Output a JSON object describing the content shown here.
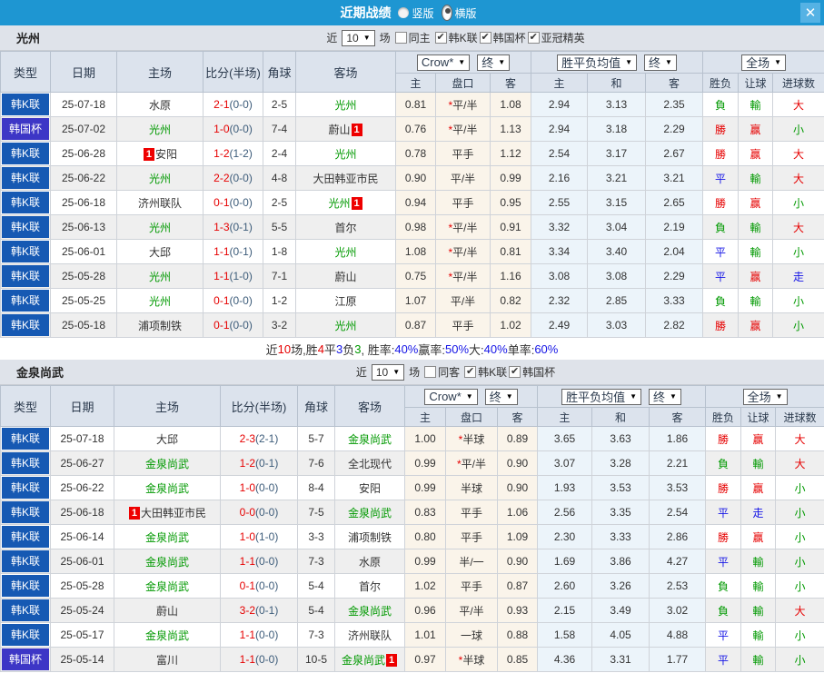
{
  "topbar": {
    "title": "近期战绩",
    "radio_vertical": "竖版",
    "radio_horizontal": "横版",
    "close": "✕"
  },
  "header_labels": {
    "cols": [
      "类型",
      "日期",
      "主场",
      "比分(半场)",
      "角球",
      "客场"
    ],
    "subs": [
      "主",
      "盘口",
      "客",
      "主",
      "和",
      "客",
      "胜负",
      "让球",
      "进球数"
    ],
    "selects": {
      "provider": "Crow*",
      "final": "终",
      "avg": "胜平负均值",
      "scope": "全场"
    }
  },
  "league_colors": {
    "韩K联": "#1659b3",
    "韩国杯": "#3d36c6"
  },
  "red_card_label": "1",
  "checkmark": "✔",
  "select_arrow": "▼",
  "sections": [
    {
      "team": "光州",
      "filter": {
        "near_label": "近",
        "games_value": "10",
        "games_suffix": "场",
        "same_label": "同主",
        "same_checked": false,
        "leagues": [
          {
            "label": "韩K联",
            "checked": true
          },
          {
            "label": "韩国杯",
            "checked": true
          },
          {
            "label": "亚冠精英",
            "checked": true
          }
        ]
      },
      "rows": [
        {
          "league": "韩K联",
          "date": "25-07-18",
          "home": {
            "name": "水原"
          },
          "score": "2-1",
          "half": "(0-0)",
          "corners": "2-5",
          "away": {
            "name": "光州",
            "green": true
          },
          "odds": [
            "0.81",
            "*平/半",
            "1.08"
          ],
          "avg": [
            "2.94",
            "3.13",
            "2.35"
          ],
          "res": [
            [
              "負",
              "g"
            ],
            [
              "輸",
              "g"
            ],
            [
              "大",
              "r"
            ]
          ]
        },
        {
          "league": "韩国杯",
          "date": "25-07-02",
          "home": {
            "name": "光州",
            "green": true
          },
          "score": "1-0",
          "half": "(0-0)",
          "corners": "7-4",
          "away": {
            "name": "蔚山",
            "badge": "after"
          },
          "odds": [
            "0.76",
            "*平/半",
            "1.13"
          ],
          "avg": [
            "2.94",
            "3.18",
            "2.29"
          ],
          "res": [
            [
              "勝",
              "r"
            ],
            [
              "赢",
              "r"
            ],
            [
              "小",
              "g"
            ]
          ]
        },
        {
          "league": "韩K联",
          "date": "25-06-28",
          "home": {
            "name": "安阳",
            "badge": "before"
          },
          "score": "1-2",
          "half": "(1-2)",
          "corners": "2-4",
          "away": {
            "name": "光州",
            "green": true
          },
          "odds": [
            "0.78",
            "平手",
            "1.12"
          ],
          "avg": [
            "2.54",
            "3.17",
            "2.67"
          ],
          "res": [
            [
              "勝",
              "r"
            ],
            [
              "赢",
              "r"
            ],
            [
              "大",
              "r"
            ]
          ]
        },
        {
          "league": "韩K联",
          "date": "25-06-22",
          "home": {
            "name": "光州",
            "green": true
          },
          "score": "2-2",
          "half": "(0-0)",
          "corners": "4-8",
          "away": {
            "name": "大田韩亚市民"
          },
          "odds": [
            "0.90",
            "平/半",
            "0.99"
          ],
          "avg": [
            "2.16",
            "3.21",
            "3.21"
          ],
          "res": [
            [
              "平",
              "b"
            ],
            [
              "輸",
              "g"
            ],
            [
              "大",
              "r"
            ]
          ]
        },
        {
          "league": "韩K联",
          "date": "25-06-18",
          "home": {
            "name": "济州联队"
          },
          "score": "0-1",
          "half": "(0-0)",
          "corners": "2-5",
          "away": {
            "name": "光州",
            "green": true,
            "badge": "after"
          },
          "odds": [
            "0.94",
            "平手",
            "0.95"
          ],
          "avg": [
            "2.55",
            "3.15",
            "2.65"
          ],
          "res": [
            [
              "勝",
              "r"
            ],
            [
              "赢",
              "r"
            ],
            [
              "小",
              "g"
            ]
          ]
        },
        {
          "league": "韩K联",
          "date": "25-06-13",
          "home": {
            "name": "光州",
            "green": true
          },
          "score": "1-3",
          "half": "(0-1)",
          "corners": "5-5",
          "away": {
            "name": "首尔"
          },
          "odds": [
            "0.98",
            "*平/半",
            "0.91"
          ],
          "avg": [
            "3.32",
            "3.04",
            "2.19"
          ],
          "res": [
            [
              "負",
              "g"
            ],
            [
              "輸",
              "g"
            ],
            [
              "大",
              "r"
            ]
          ]
        },
        {
          "league": "韩K联",
          "date": "25-06-01",
          "home": {
            "name": "大邱"
          },
          "score": "1-1",
          "half": "(0-1)",
          "corners": "1-8",
          "away": {
            "name": "光州",
            "green": true
          },
          "odds": [
            "1.08",
            "*平/半",
            "0.81"
          ],
          "avg": [
            "3.34",
            "3.40",
            "2.04"
          ],
          "res": [
            [
              "平",
              "b"
            ],
            [
              "輸",
              "g"
            ],
            [
              "小",
              "g"
            ]
          ]
        },
        {
          "league": "韩K联",
          "date": "25-05-28",
          "home": {
            "name": "光州",
            "green": true
          },
          "score": "1-1",
          "half": "(1-0)",
          "corners": "7-1",
          "away": {
            "name": "蔚山"
          },
          "odds": [
            "0.75",
            "*平/半",
            "1.16"
          ],
          "avg": [
            "3.08",
            "3.08",
            "2.29"
          ],
          "res": [
            [
              "平",
              "b"
            ],
            [
              "赢",
              "r"
            ],
            [
              "走",
              "b"
            ]
          ]
        },
        {
          "league": "韩K联",
          "date": "25-05-25",
          "home": {
            "name": "光州",
            "green": true
          },
          "score": "0-1",
          "half": "(0-0)",
          "corners": "1-2",
          "away": {
            "name": "江原"
          },
          "odds": [
            "1.07",
            "平/半",
            "0.82"
          ],
          "avg": [
            "2.32",
            "2.85",
            "3.33"
          ],
          "res": [
            [
              "負",
              "g"
            ],
            [
              "輸",
              "g"
            ],
            [
              "小",
              "g"
            ]
          ]
        },
        {
          "league": "韩K联",
          "date": "25-05-18",
          "home": {
            "name": "浦项制铁"
          },
          "score": "0-1",
          "half": "(0-0)",
          "corners": "3-2",
          "away": {
            "name": "光州",
            "green": true
          },
          "odds": [
            "0.87",
            "平手",
            "1.02"
          ],
          "avg": [
            "2.49",
            "3.03",
            "2.82"
          ],
          "res": [
            [
              "勝",
              "r"
            ],
            [
              "赢",
              "r"
            ],
            [
              "小",
              "g"
            ]
          ]
        }
      ],
      "summary": [
        {
          "t": "近",
          "c": "#333333"
        },
        {
          "t": "10",
          "c": "#e60000"
        },
        {
          "t": "场,胜",
          "c": "#333333"
        },
        {
          "t": "4",
          "c": "#e60000"
        },
        {
          "t": "平",
          "c": "#333333"
        },
        {
          "t": "3",
          "c": "#1414e6"
        },
        {
          "t": "负",
          "c": "#333333"
        },
        {
          "t": "3",
          "c": "#009900"
        },
        {
          "t": ", 胜率:",
          "c": "#333333"
        },
        {
          "t": "40%",
          "c": "#1414e6"
        },
        {
          "t": " 赢率:",
          "c": "#333333"
        },
        {
          "t": "50%",
          "c": "#1414e6"
        },
        {
          "t": " 大:",
          "c": "#333333"
        },
        {
          "t": "40%",
          "c": "#1414e6"
        },
        {
          "t": " 单率:",
          "c": "#333333"
        },
        {
          "t": "60%",
          "c": "#1414e6"
        }
      ]
    },
    {
      "team": "金泉尚武",
      "filter": {
        "near_label": "近",
        "games_value": "10",
        "games_suffix": "场",
        "same_label": "同客",
        "same_checked": false,
        "leagues": [
          {
            "label": "韩K联",
            "checked": true
          },
          {
            "label": "韩国杯",
            "checked": true
          }
        ]
      },
      "rows": [
        {
          "league": "韩K联",
          "date": "25-07-18",
          "home": {
            "name": "大邱"
          },
          "score": "2-3",
          "half": "(2-1)",
          "corners": "5-7",
          "away": {
            "name": "金泉尚武",
            "green": true
          },
          "odds": [
            "1.00",
            "*半球",
            "0.89"
          ],
          "avg": [
            "3.65",
            "3.63",
            "1.86"
          ],
          "res": [
            [
              "勝",
              "r"
            ],
            [
              "赢",
              "r"
            ],
            [
              "大",
              "r"
            ]
          ]
        },
        {
          "league": "韩K联",
          "date": "25-06-27",
          "home": {
            "name": "金泉尚武",
            "green": true
          },
          "score": "1-2",
          "half": "(0-1)",
          "corners": "7-6",
          "away": {
            "name": "全北现代"
          },
          "odds": [
            "0.99",
            "*平/半",
            "0.90"
          ],
          "avg": [
            "3.07",
            "3.28",
            "2.21"
          ],
          "res": [
            [
              "負",
              "g"
            ],
            [
              "輸",
              "g"
            ],
            [
              "大",
              "r"
            ]
          ]
        },
        {
          "league": "韩K联",
          "date": "25-06-22",
          "home": {
            "name": "金泉尚武",
            "green": true
          },
          "score": "1-0",
          "half": "(0-0)",
          "corners": "8-4",
          "away": {
            "name": "安阳"
          },
          "odds": [
            "0.99",
            "半球",
            "0.90"
          ],
          "avg": [
            "1.93",
            "3.53",
            "3.53"
          ],
          "res": [
            [
              "勝",
              "r"
            ],
            [
              "赢",
              "r"
            ],
            [
              "小",
              "g"
            ]
          ]
        },
        {
          "league": "韩K联",
          "date": "25-06-18",
          "home": {
            "name": "大田韩亚市民",
            "badge": "before"
          },
          "score": "0-0",
          "half": "(0-0)",
          "corners": "7-5",
          "away": {
            "name": "金泉尚武",
            "green": true
          },
          "odds": [
            "0.83",
            "平手",
            "1.06"
          ],
          "avg": [
            "2.56",
            "3.35",
            "2.54"
          ],
          "res": [
            [
              "平",
              "b"
            ],
            [
              "走",
              "b"
            ],
            [
              "小",
              "g"
            ]
          ]
        },
        {
          "league": "韩K联",
          "date": "25-06-14",
          "home": {
            "name": "金泉尚武",
            "green": true
          },
          "score": "1-0",
          "half": "(1-0)",
          "corners": "3-3",
          "away": {
            "name": "浦项制铁"
          },
          "odds": [
            "0.80",
            "平手",
            "1.09"
          ],
          "avg": [
            "2.30",
            "3.33",
            "2.86"
          ],
          "res": [
            [
              "勝",
              "r"
            ],
            [
              "赢",
              "r"
            ],
            [
              "小",
              "g"
            ]
          ]
        },
        {
          "league": "韩K联",
          "date": "25-06-01",
          "home": {
            "name": "金泉尚武",
            "green": true
          },
          "score": "1-1",
          "half": "(0-0)",
          "corners": "7-3",
          "away": {
            "name": "水原"
          },
          "odds": [
            "0.99",
            "半/一",
            "0.90"
          ],
          "avg": [
            "1.69",
            "3.86",
            "4.27"
          ],
          "res": [
            [
              "平",
              "b"
            ],
            [
              "輸",
              "g"
            ],
            [
              "小",
              "g"
            ]
          ]
        },
        {
          "league": "韩K联",
          "date": "25-05-28",
          "home": {
            "name": "金泉尚武",
            "green": true
          },
          "score": "0-1",
          "half": "(0-0)",
          "corners": "5-4",
          "away": {
            "name": "首尔"
          },
          "odds": [
            "1.02",
            "平手",
            "0.87"
          ],
          "avg": [
            "2.60",
            "3.26",
            "2.53"
          ],
          "res": [
            [
              "負",
              "g"
            ],
            [
              "輸",
              "g"
            ],
            [
              "小",
              "g"
            ]
          ]
        },
        {
          "league": "韩K联",
          "date": "25-05-24",
          "home": {
            "name": "蔚山"
          },
          "score": "3-2",
          "half": "(0-1)",
          "corners": "5-4",
          "away": {
            "name": "金泉尚武",
            "green": true
          },
          "odds": [
            "0.96",
            "平/半",
            "0.93"
          ],
          "avg": [
            "2.15",
            "3.49",
            "3.02"
          ],
          "res": [
            [
              "負",
              "g"
            ],
            [
              "輸",
              "g"
            ],
            [
              "大",
              "r"
            ]
          ]
        },
        {
          "league": "韩K联",
          "date": "25-05-17",
          "home": {
            "name": "金泉尚武",
            "green": true
          },
          "score": "1-1",
          "half": "(0-0)",
          "corners": "7-3",
          "away": {
            "name": "济州联队"
          },
          "odds": [
            "1.01",
            "一球",
            "0.88"
          ],
          "avg": [
            "1.58",
            "4.05",
            "4.88"
          ],
          "res": [
            [
              "平",
              "b"
            ],
            [
              "輸",
              "g"
            ],
            [
              "小",
              "g"
            ]
          ]
        },
        {
          "league": "韩国杯",
          "date": "25-05-14",
          "home": {
            "name": "富川"
          },
          "score": "1-1",
          "half": "(0-0)",
          "corners": "10-5",
          "away": {
            "name": "金泉尚武",
            "green": true,
            "badge": "after"
          },
          "odds": [
            "0.97",
            "*半球",
            "0.85"
          ],
          "avg": [
            "4.36",
            "3.31",
            "1.77"
          ],
          "res": [
            [
              "平",
              "b"
            ],
            [
              "輸",
              "g"
            ],
            [
              "小",
              "g"
            ]
          ]
        }
      ],
      "summary": null
    }
  ]
}
